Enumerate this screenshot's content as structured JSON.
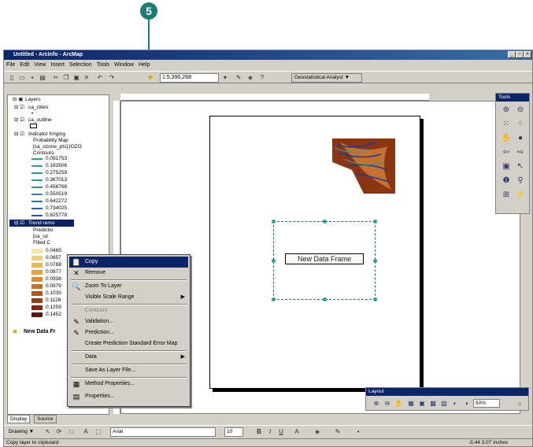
{
  "callout": {
    "number": "5"
  },
  "window": {
    "title": "Untitled - ArcInfo - ArcMap",
    "controls": [
      "_",
      "▫",
      "×"
    ],
    "menus": [
      "File",
      "Edit",
      "View",
      "Insert",
      "Selection",
      "Tools",
      "Window",
      "Help"
    ],
    "scale_value": "1:5,390,268",
    "geostat_label": "Geostatistical Analyst ▼"
  },
  "toc": {
    "root": "Layers",
    "layers": [
      "ca_cities",
      "ca_outline",
      "Indicator Kriging",
      "Trend remo"
    ],
    "kriging_sub": [
      "Probability Map",
      "[ca_ozone_pts].[OZO",
      "Contours"
    ],
    "contour_values": [
      "0.091753",
      "0.183506",
      "0.275259",
      "0.367013",
      "0.458766",
      "0.550519",
      "0.642272",
      "0.734025",
      "0.825778"
    ],
    "trend_sub": [
      "Predictio",
      "[ca_oz",
      "Filled C"
    ],
    "filled_values": [
      "0.0465",
      "0.0657",
      "0.0788",
      "0.0877",
      "0.0938",
      "0.0979",
      "0.1035",
      "0.1128",
      "0.1259",
      "0.1452"
    ],
    "filled_colors": [
      "#f5e6a8",
      "#f0d070",
      "#ebb94a",
      "#e6a23a",
      "#d98a2c",
      "#c87024",
      "#b0561e",
      "#963e18",
      "#7c2a12",
      "#5e1a0c"
    ],
    "new_frame": "New Data Fr",
    "tabs": [
      "Display",
      "Source"
    ]
  },
  "context_menu": {
    "items": [
      {
        "label": "Copy",
        "icon": "📋",
        "highlight": true
      },
      {
        "label": "Remove",
        "icon": "✕"
      },
      {
        "label": "Zoom To Layer",
        "icon": "🔍"
      },
      {
        "label": "Visible Scale Range",
        "submenu": true
      },
      {
        "label": "Contours",
        "disabled": true
      },
      {
        "label": "Validation...",
        "icon": "✎"
      },
      {
        "label": "Prediction...",
        "icon": "✎"
      },
      {
        "label": "Create Prediction Standard Error Map"
      },
      {
        "label": "Data",
        "submenu": true
      },
      {
        "label": "Save As Layer File..."
      },
      {
        "label": "Method Properties...",
        "icon": "▦"
      },
      {
        "label": "Properties...",
        "icon": "▤"
      }
    ]
  },
  "layout": {
    "frame_label": "New Data Frame",
    "toolbar_title": "Layout",
    "zoom": "50%"
  },
  "tools": {
    "title": "Tools"
  },
  "drawbar": {
    "drawing": "Drawing ▼",
    "font": "Arial",
    "size": "10"
  },
  "status": {
    "message": "Copy layer to clipboard",
    "coords": "-3.44  3.07 Inches"
  }
}
